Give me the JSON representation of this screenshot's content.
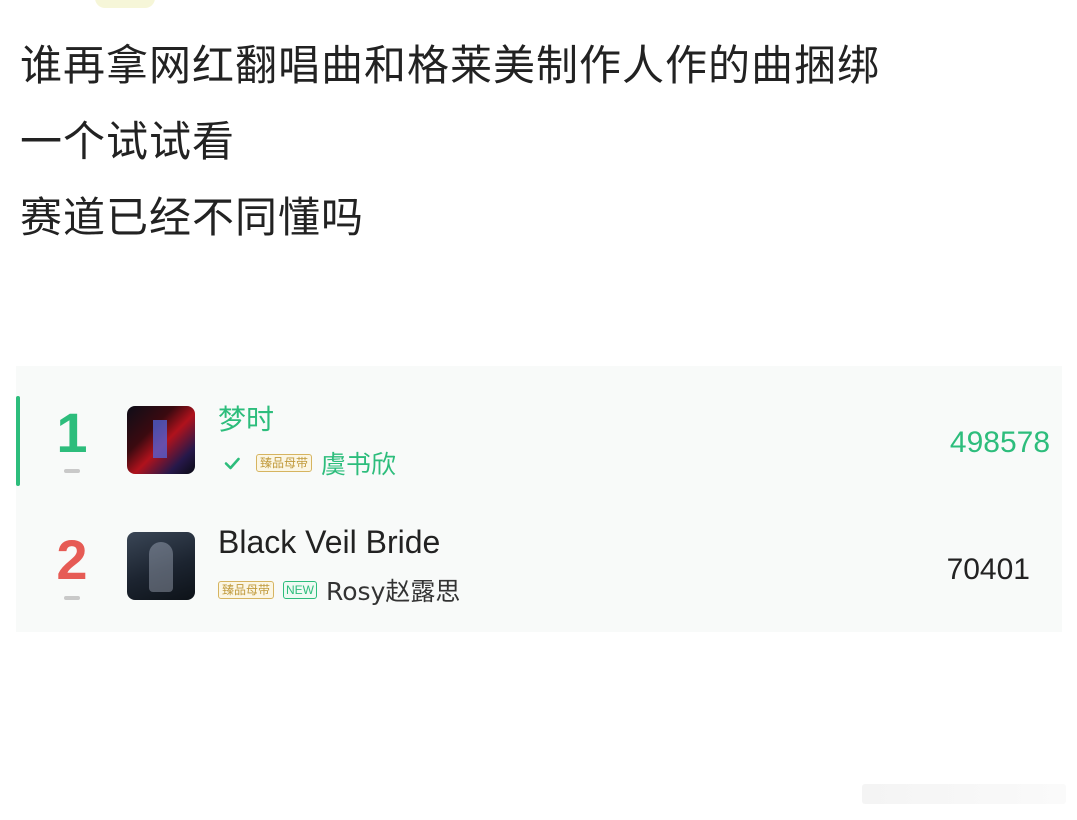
{
  "post": {
    "lines": [
      "谁再拿网红翻唱曲和格莱美制作人作的曲捆绑",
      "一个试试看",
      "赛道已经不同懂吗"
    ]
  },
  "chart_list": {
    "accent_color": "#2dbd7c",
    "rank2_color": "#e65b55",
    "badge_text": "臻品母带",
    "new_tag": "NEW",
    "items": [
      {
        "rank": "1",
        "title": "梦时",
        "artist": "虞书欣",
        "count": "498578",
        "verified": true
      },
      {
        "rank": "2",
        "title": "Black Veil Bride",
        "artist": "Rosy赵露思",
        "count": "70401",
        "verified": false
      }
    ]
  },
  "icons": {
    "verified": "check-icon",
    "rank_trend": "dash-icon"
  }
}
